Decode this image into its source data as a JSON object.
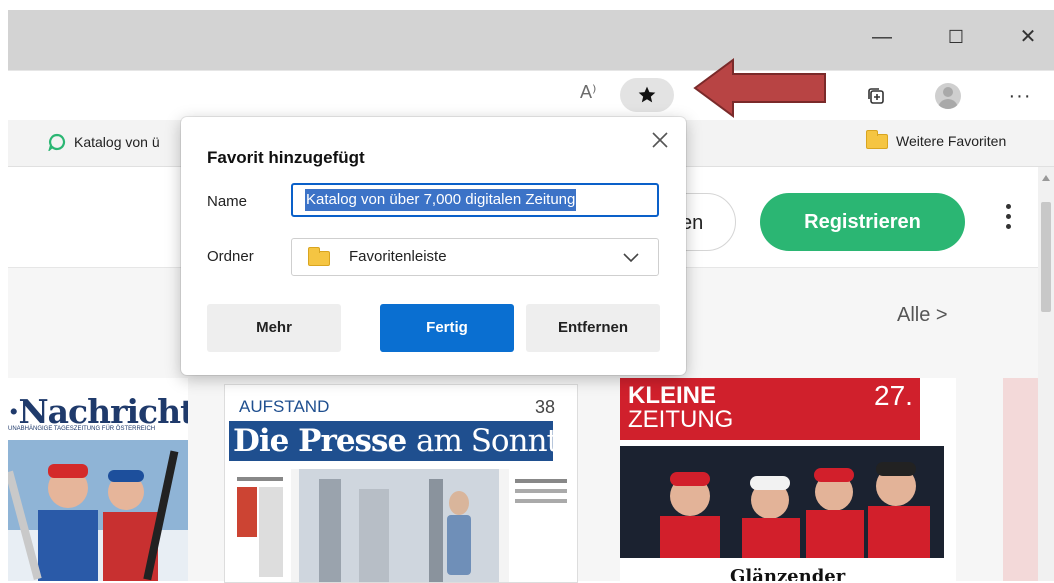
{
  "window": {
    "minimize_glyph": "—",
    "maximize_glyph": "☐",
    "close_glyph": "✕"
  },
  "toolbar": {
    "read_aloud": "A⁾",
    "favorite_icon": "star-filled",
    "collections_icon": "collections-icon",
    "more_glyph": "···"
  },
  "favorites_bar": {
    "item1_label": "Katalog von ü",
    "item2_label": "Weitere Favoriten"
  },
  "page": {
    "login_partial": "en",
    "register_label": "Registrieren",
    "see_all_label": "Alle >"
  },
  "newspapers": {
    "p1_title": "·Nachrichten",
    "p1_sub": "UNABHÄNGIGE TAGESZEITUNG FÜR ÖSTERREICH",
    "p2_top": "AUFSTAND",
    "p2_num": "38",
    "p2_title_bold": "Die Presse",
    "p2_title_thin": "am Sonntag",
    "p3_title_line1": "KLEINE",
    "p3_title_line2": "ZEITUNG",
    "p3_date": "27.",
    "p3_caption": "Glänzender"
  },
  "dialog": {
    "title": "Favorit hinzugefügt",
    "name_label": "Name",
    "name_value": "Katalog von über 7,000 digitalen Zeitung",
    "folder_label": "Ordner",
    "folder_value": "Favoritenleiste",
    "more_button": "Mehr",
    "done_button": "Fertig",
    "remove_button": "Entfernen"
  },
  "colors": {
    "accent_blue": "#0a6fd1",
    "register_green": "#2bb673",
    "arrow_red": "#b84444"
  }
}
